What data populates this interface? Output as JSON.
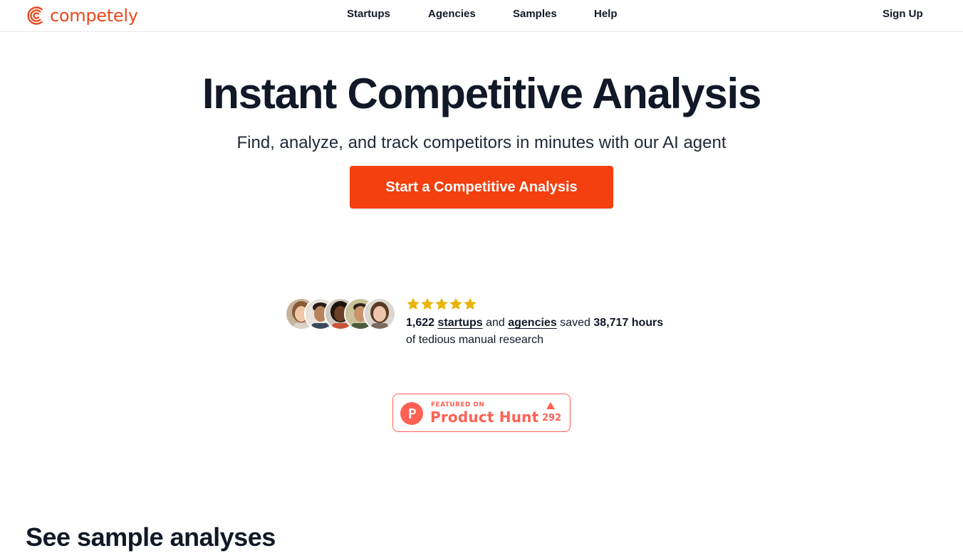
{
  "brand": {
    "name": "competely",
    "logo_icon": "competely-logo-icon",
    "color": "#e8491d"
  },
  "nav": {
    "items": [
      {
        "label": "Startups"
      },
      {
        "label": "Agencies"
      },
      {
        "label": "Samples"
      },
      {
        "label": "Help"
      }
    ],
    "signup_label": "Sign Up"
  },
  "hero": {
    "title": "Instant Competitive Analysis",
    "subtitle": "Find, analyze, and track competitors in minutes with our AI agent",
    "cta_label": "Start a Competitive Analysis",
    "cta_color": "#f43f0e"
  },
  "social_proof": {
    "rating_stars": 5,
    "star_color": "#eab308",
    "count": "1,622",
    "startups_link": "startups",
    "and_text": "and",
    "agencies_link": "agencies",
    "saved_text": "saved",
    "hours": "38,717 hours",
    "line2": "of tedious manual research",
    "avatar_icons": [
      "avatar-icon",
      "avatar-icon",
      "avatar-icon",
      "avatar-icon",
      "avatar-icon"
    ]
  },
  "product_hunt": {
    "featured_label": "FEATURED ON",
    "name": "Product Hunt",
    "upvotes": "292",
    "color": "#ff6154"
  },
  "samples_section": {
    "title": "See sample analyses"
  }
}
